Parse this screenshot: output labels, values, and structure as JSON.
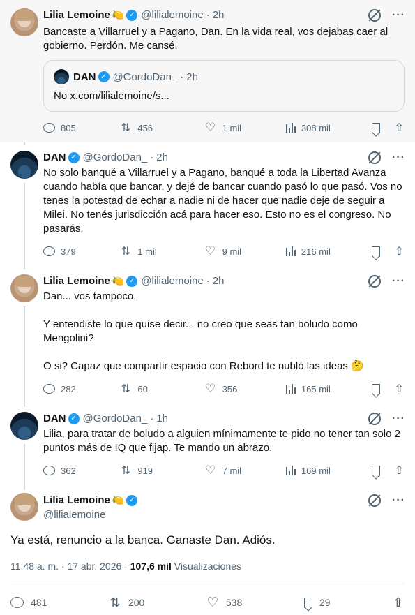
{
  "tweets": [
    {
      "name": "Lilia Lemoine",
      "emoji": "🍋",
      "handle": "@lilialemoine",
      "time": "2h",
      "text": "Bancaste a Villarruel y a Pagano, Dan. En la vida real, vos dejabas caer al gobierno. Perdón. Me cansé.",
      "quote": {
        "name": "DAN",
        "handle": "@GordoDan_",
        "time": "2h",
        "text": "No x.com/lilialemoine/s..."
      },
      "replies": "805",
      "reposts": "456",
      "likes": "1 mil",
      "views": "308 mil"
    },
    {
      "name": "DAN",
      "handle": "@GordoDan_",
      "time": "2h",
      "text": "No solo banqué a Villarruel y a Pagano, banqué a toda la Libertad Avanza cuando había que bancar, y dejé de bancar cuando pasó lo que pasó. Vos no tenes la potestad de echar a nadie ni de hacer que nadie deje de seguir a Milei. No tenés jurisdicción acá para hacer eso. Esto no es el congreso. No pasarás.",
      "replies": "379",
      "reposts": "1 mil",
      "likes": "9 mil",
      "views": "216 mil"
    },
    {
      "name": "Lilia Lemoine",
      "emoji": "🍋",
      "handle": "@lilialemoine",
      "time": "2h",
      "text": "Dan... vos tampoco.\n\nY entendiste lo que quise decir... no creo que seas tan boludo como Mengolini?\n\nO si? Capaz que compartir espacio con Rebord te nubló las ideas 🤔",
      "replies": "282",
      "reposts": "60",
      "likes": "356",
      "views": "165 mil"
    },
    {
      "name": "DAN",
      "handle": "@GordoDan_",
      "time": "1h",
      "text": "Lilia, para tratar de boludo a alguien mínimamente te pido no tener tan solo 2 puntos más de IQ que fijap. Te mando un abrazo.",
      "replies": "362",
      "reposts": "919",
      "likes": "7 mil",
      "views": "169 mil"
    }
  ],
  "main": {
    "name": "Lilia Lemoine",
    "emoji": "🍋",
    "handle": "@lilialemoine",
    "text": "Ya está, renuncio a la banca. Ganaste Dan. Adiós.",
    "timestamp": "11:48 a. m. · 17 abr. 2026 ·",
    "views_count": "107,6 mil",
    "views_label": "Visualizaciones",
    "replies": "481",
    "reposts": "200",
    "likes": "538",
    "bookmarks": "29"
  },
  "icons": [
    "grok-icon",
    "more-icon",
    "reply-icon",
    "repost-icon",
    "like-icon",
    "views-icon",
    "bookmark-icon",
    "share-icon",
    "verified-icon"
  ],
  "colors": {
    "verified": "#1d9bf0",
    "secondary_text": "#536471",
    "thread_line": "#cfd9de",
    "highlight_bg": "#f7f7f7"
  }
}
